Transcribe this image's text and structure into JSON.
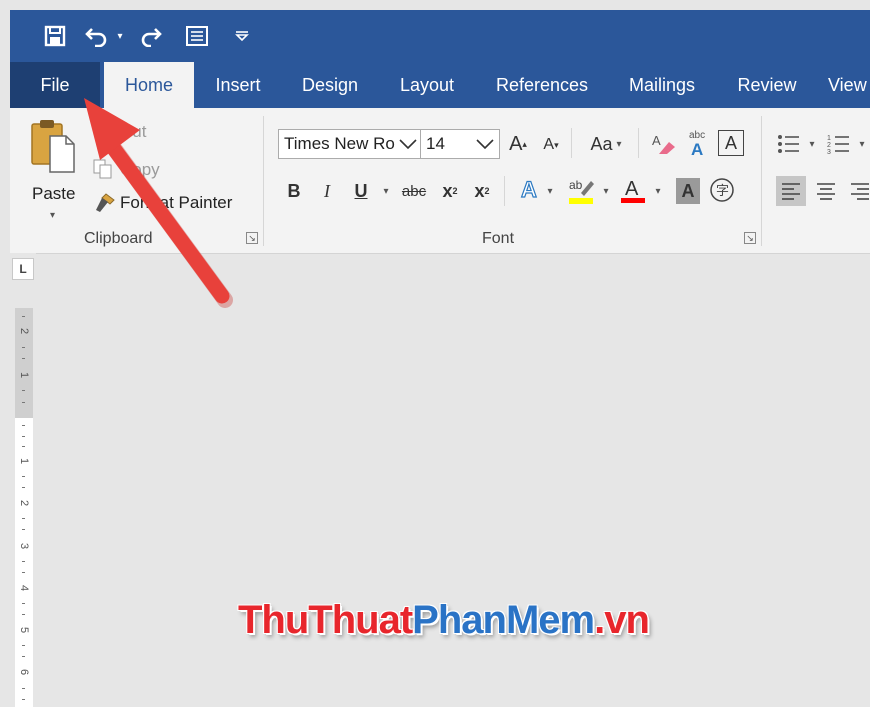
{
  "tabs": {
    "file": "File",
    "home": "Home",
    "insert": "Insert",
    "design": "Design",
    "layout": "Layout",
    "references": "References",
    "mailings": "Mailings",
    "review": "Review",
    "view": "View"
  },
  "clipboard": {
    "paste": "Paste",
    "cut": "Cut",
    "copy": "Copy",
    "format_painter": "Format Painter",
    "group_label": "Clipboard"
  },
  "font": {
    "font_name": "Times New Roman",
    "font_size": "14",
    "change_case": "Aa",
    "group_label": "Font"
  },
  "ruler": {
    "tab_selector": "L",
    "numbers": [
      "2",
      "1",
      "1",
      "2",
      "3",
      "4",
      "5",
      "6"
    ]
  },
  "watermark": {
    "part1": "ThuThuat",
    "part2": "PhanMem",
    "part3": ".vn"
  },
  "colors": {
    "title_bar": "#2b579a",
    "file_tab": "#1e3f72",
    "ribbon": "#f3f3f3",
    "annotation_arrow": "#e8413b",
    "highlight_yellow": "#ffff00",
    "font_color_red": "#ff0000",
    "watermark_red": "#e8262c",
    "watermark_blue": "#2a73c6"
  }
}
